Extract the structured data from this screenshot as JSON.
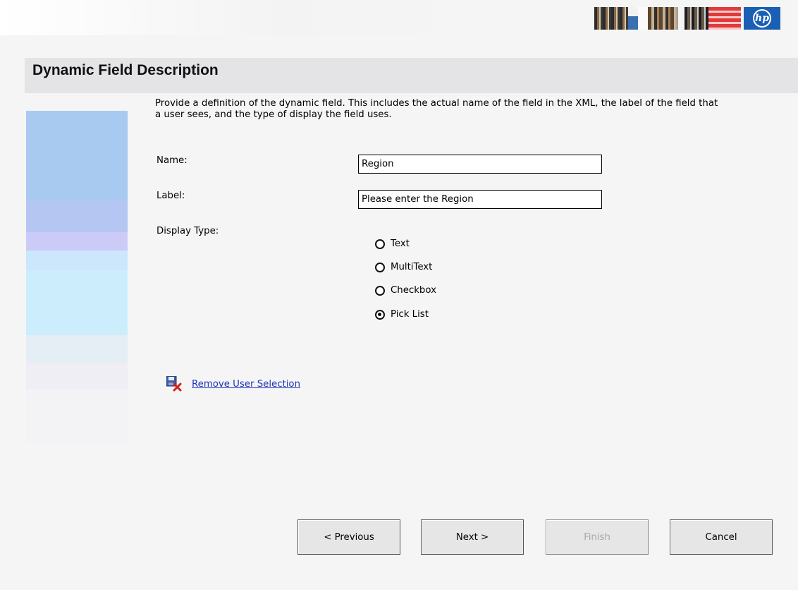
{
  "header": {
    "title": "Dynamic Field Description",
    "logo_text": "hp"
  },
  "description": "Provide a definition of the dynamic field.  This includes the actual name of the field in the XML, the label of the field that a user sees, and the type of display the field uses.",
  "form": {
    "name_label": "Name:",
    "name_value": "Region",
    "label_label": "Label:",
    "label_value": "Please enter the Region",
    "display_type_label": "Display Type:",
    "display_options": [
      {
        "label": "Text",
        "checked": false
      },
      {
        "label": "MultiText",
        "checked": false
      },
      {
        "label": "Checkbox",
        "checked": false
      },
      {
        "label": "Pick List",
        "checked": true
      }
    ]
  },
  "remove_selection_label": "Remove User Selection",
  "buttons": {
    "previous": "< Previous",
    "next": "Next >",
    "finish": "Finish",
    "cancel": "Cancel"
  },
  "colors": {
    "title_band": "#e4e3e6",
    "link": "#1d36b6",
    "hp_blue": "#1a5fb4"
  }
}
